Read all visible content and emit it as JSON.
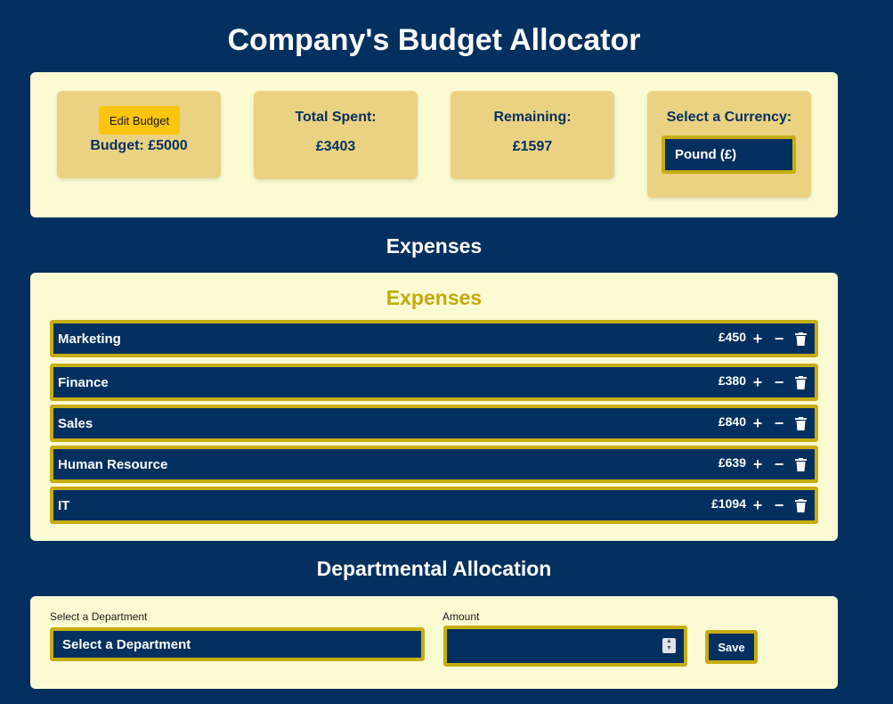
{
  "header": {
    "title": "Company's Budget Allocator"
  },
  "summary": {
    "edit_label": "Edit Budget",
    "budget_text": "Budget: £5000",
    "spent_label": "Total Spent:",
    "spent_value": "£3403",
    "remaining_label": "Remaining:",
    "remaining_value": "£1597",
    "currency_label": "Select a Currency:",
    "currency_value": "Pound (£)"
  },
  "expenses": {
    "heading": "Expenses",
    "panel_title": "Expenses",
    "items": [
      {
        "name": "Marketing",
        "amount": "£450"
      },
      {
        "name": "Finance",
        "amount": "£380"
      },
      {
        "name": "Sales",
        "amount": "£840"
      },
      {
        "name": "Human Resource",
        "amount": "£639"
      },
      {
        "name": "IT",
        "amount": "£1094"
      }
    ]
  },
  "allocation": {
    "heading": "Departmental Allocation",
    "department_label": "Select a Department",
    "department_value": "Select a Department",
    "amount_label": "Amount",
    "amount_value": "",
    "save_label": "Save"
  },
  "colors": {
    "background": "#03305f",
    "panel": "#fbfbd3",
    "card": "#ebd282",
    "accent": "#c6ad10",
    "button": "#fbc40d"
  },
  "icons": [
    "plus-icon",
    "minus-icon",
    "trash-icon",
    "spinner-icon"
  ]
}
